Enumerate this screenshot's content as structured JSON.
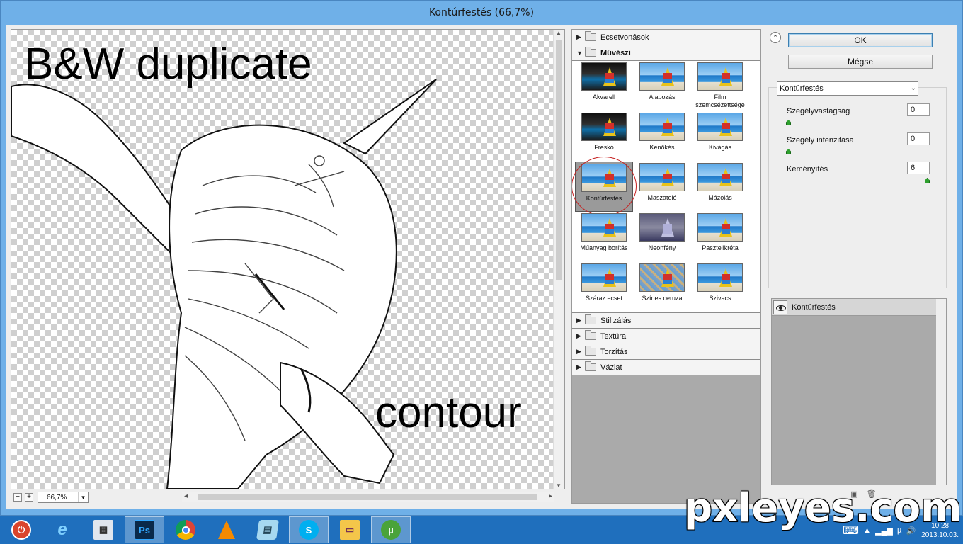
{
  "window": {
    "title": "Kontúrfestés (66,7%)"
  },
  "preview": {
    "overlay_title": "B&W duplicate",
    "overlay_sub": "contour",
    "zoom_minus": "−",
    "zoom_plus": "+",
    "zoom_value": "66,7%"
  },
  "gallery": {
    "categories_top": [
      {
        "label": "Ecsetvonások",
        "expanded": false
      },
      {
        "label": "Művészi",
        "expanded": true
      }
    ],
    "thumbnails": [
      {
        "label": "Akvarell",
        "style": "dark-top"
      },
      {
        "label": "Alapozás",
        "style": "sea"
      },
      {
        "label": "Film szemcsézettsége",
        "style": "sea"
      },
      {
        "label": "Freskó",
        "style": "dark"
      },
      {
        "label": "Kenőkés",
        "style": "sea"
      },
      {
        "label": "Kivágás",
        "style": "sea"
      },
      {
        "label": "Kontúrfestés",
        "style": "sea",
        "selected": true
      },
      {
        "label": "Maszatoló",
        "style": "sea"
      },
      {
        "label": "Mázolás",
        "style": "sea"
      },
      {
        "label": "Műanyag borítás",
        "style": "sea"
      },
      {
        "label": "Neonfény",
        "style": "neon"
      },
      {
        "label": "Pasztellkréta",
        "style": "sea"
      },
      {
        "label": "Száraz ecset",
        "style": "sea"
      },
      {
        "label": "Színes ceruza",
        "style": "pencil"
      },
      {
        "label": "Szivacs",
        "style": "sea"
      }
    ],
    "categories_bottom": [
      {
        "label": "Stilizálás"
      },
      {
        "label": "Textúra"
      },
      {
        "label": "Torzítás"
      },
      {
        "label": "Vázlat"
      }
    ]
  },
  "panel": {
    "ok_label": "OK",
    "cancel_label": "Mégse",
    "filter_select": "Kontúrfestés",
    "params": [
      {
        "label": "Szegélyvastagság",
        "value": "0",
        "fraction": 0.0
      },
      {
        "label": "Szegély intenzitása",
        "value": "0",
        "fraction": 0.0
      },
      {
        "label": "Keményítés",
        "value": "6",
        "fraction": 1.0
      }
    ],
    "layer_label": "Kontúrfestés"
  },
  "taskbar": {
    "apps": [
      "power-icon",
      "ie-icon",
      "calculator-icon",
      "photoshop-icon",
      "chrome-icon",
      "vlc-icon",
      "notepad-icon",
      "skype-icon",
      "explorer-icon",
      "utorrent-icon"
    ],
    "active_app": "photoshop-icon",
    "clock_time": "10:28",
    "clock_date": "2013.10.03."
  },
  "watermark": "pxleyes.com"
}
